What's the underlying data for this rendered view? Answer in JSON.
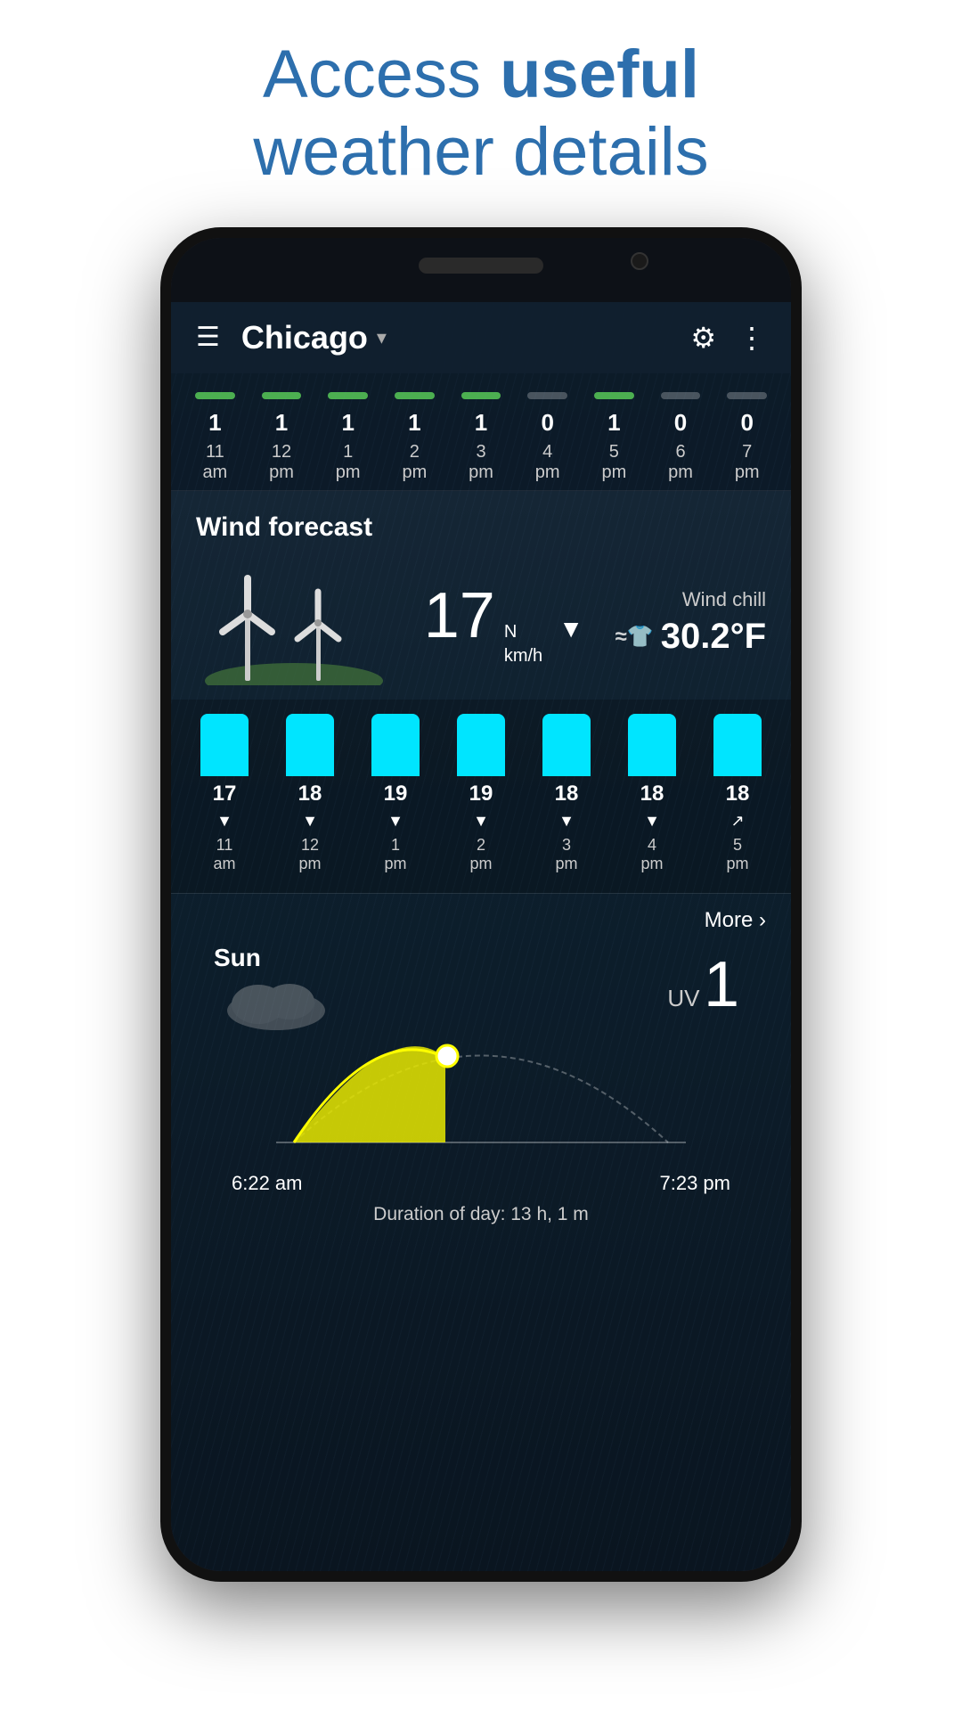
{
  "headline": {
    "line1": "Access ",
    "line1_bold": "useful",
    "line2": "weather details"
  },
  "nav": {
    "menu_label": "☰",
    "city": "Chicago",
    "dropdown_arrow": "▾",
    "settings_label": "⚙",
    "more_label": "⋮"
  },
  "precipitation": {
    "columns": [
      {
        "bar": "green",
        "value": "1",
        "time": "11",
        "period": "am"
      },
      {
        "bar": "green",
        "value": "1",
        "time": "12",
        "period": "pm"
      },
      {
        "bar": "green",
        "value": "1",
        "time": "1",
        "period": "pm"
      },
      {
        "bar": "green",
        "value": "1",
        "time": "2",
        "period": "pm"
      },
      {
        "bar": "green",
        "value": "1",
        "time": "3",
        "period": "pm"
      },
      {
        "bar": "gray",
        "value": "0",
        "time": "4",
        "period": "pm"
      },
      {
        "bar": "green",
        "value": "1",
        "time": "5",
        "period": "pm"
      },
      {
        "bar": "gray",
        "value": "0",
        "time": "6",
        "period": "pm"
      },
      {
        "bar": "gray",
        "value": "0",
        "time": "7",
        "period": "pm"
      }
    ]
  },
  "wind_forecast": {
    "title": "Wind forecast",
    "speed": "17",
    "speed_unit_top": "N",
    "speed_unit_bottom": "km/h",
    "direction_arrow": "▼",
    "wind_chill_label": "Wind chill",
    "wind_chill_icon": "≈👕",
    "wind_chill_value": "30.2°F"
  },
  "wind_bars": {
    "columns": [
      {
        "speed": "17",
        "arrow": "▼",
        "time": "11",
        "period": "am"
      },
      {
        "speed": "18",
        "arrow": "▼",
        "time": "12",
        "period": "pm"
      },
      {
        "speed": "19",
        "arrow": "▼",
        "time": "1",
        "period": "pm"
      },
      {
        "speed": "19",
        "arrow": "▼",
        "time": "2",
        "period": "pm"
      },
      {
        "speed": "18",
        "arrow": "▼",
        "time": "3",
        "period": "pm"
      },
      {
        "speed": "18",
        "arrow": "▼",
        "time": "4",
        "period": "pm"
      },
      {
        "speed": "18",
        "arrow": "↗",
        "time": "5",
        "period": "pm"
      }
    ]
  },
  "sun_section": {
    "more_text": "More",
    "more_arrow": "›",
    "label": "Sun",
    "uv_label": "UV",
    "uv_value": "1",
    "sunrise": "6:22 am",
    "sunset": "7:23 pm",
    "duration": "Duration of day: 13 h, 1 m"
  }
}
